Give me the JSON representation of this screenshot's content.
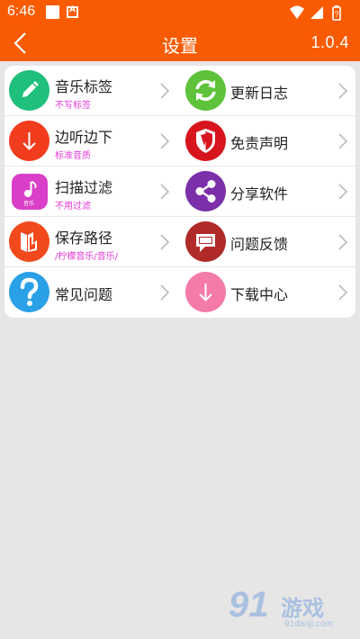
{
  "status_bar": {
    "time": "6:46",
    "notification_icons": [
      "square-icon",
      "a-icon"
    ],
    "notification_letter": "A",
    "system_icons": [
      "wifi-icon",
      "signal-icon",
      "battery-icon"
    ]
  },
  "header": {
    "title": "设置",
    "version": "1.0.4",
    "back_icon": "back-arrow-icon",
    "bg_color": "#f95b03"
  },
  "settings": {
    "rows": [
      {
        "left": {
          "label": "音乐标签",
          "sub": "不写标签",
          "icon": "pencil-icon",
          "color": "#1fbf7c"
        },
        "right": {
          "label": "更新日志",
          "sub": "",
          "icon": "refresh-icon",
          "color": "#5ec23a"
        }
      },
      {
        "left": {
          "label": "边听边下",
          "sub": "标准音质",
          "icon": "download-arrow-icon",
          "color": "#f23c1e"
        },
        "right": {
          "label": "免责声明",
          "sub": "",
          "icon": "shield-icon",
          "color": "#d8151f"
        }
      },
      {
        "left": {
          "label": "扫描过滤",
          "sub": "不用过滤",
          "icon": "music-note-icon",
          "color": "#d93fc8",
          "icon_text": "音乐"
        },
        "right": {
          "label": "分享软件",
          "sub": "",
          "icon": "share-icon",
          "color": "#7b2fa8"
        }
      },
      {
        "left": {
          "label": "保存路径",
          "sub": "/柠檬音乐/音乐/",
          "icon": "folder-path-icon",
          "color": "#f24a1c"
        },
        "right": {
          "label": "问题反馈",
          "sub": "",
          "icon": "feedback-icon",
          "color": "#b02a2a"
        }
      },
      {
        "left": {
          "label": "常见问题",
          "sub": "",
          "icon": "question-icon",
          "color": "#2aa0e6"
        },
        "right": {
          "label": "下载中心",
          "sub": "",
          "icon": "download-center-icon",
          "color": "#f47aa8"
        }
      }
    ],
    "chevron_icon": "chevron-right-icon"
  },
  "watermark": {
    "number": "91",
    "name": "游戏",
    "url": "91danji.com"
  }
}
